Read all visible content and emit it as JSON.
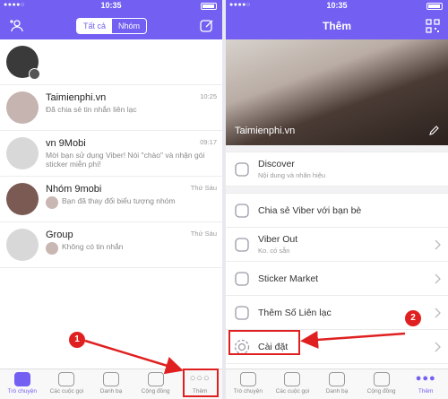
{
  "status": {
    "time": "10:35",
    "signal": "●●●●○"
  },
  "left": {
    "segment": [
      "Tất cả",
      "Nhóm"
    ],
    "chats": [
      {
        "name": "",
        "message": "",
        "time": "",
        "avatar": "#3a3a3a",
        "lock": true
      },
      {
        "name": "Taimienphi.vn",
        "message": "Đã chia sẻ tin nhắn liên lạc",
        "time": "10:25",
        "avatar": "#c5b4b0"
      },
      {
        "name": "vn 9Mobi",
        "message": "Mời bạn sử dụng Viber! Nói \"chào\" và nhận gói sticker miễn phí!",
        "time": "09:17",
        "avatar": "#d8d8d8"
      },
      {
        "name": "Nhóm 9mobi",
        "message": "Bạn đã thay đổi biểu tượng nhóm",
        "time": "Thứ Sáu",
        "avatar": "#7a5a52"
      },
      {
        "name": "Group",
        "message": "Không có tin nhắn",
        "time": "Thứ Sáu",
        "avatar": "#d8d8d8"
      }
    ],
    "tabs": [
      "Trò chuyện",
      "Các cuộc gọi",
      "Danh bạ",
      "Cộng đồng",
      "Thêm"
    ]
  },
  "right": {
    "title": "Thêm",
    "profile_name": "Taimienphi.vn",
    "menu": [
      {
        "label": "Discover",
        "sub": "Nội dung và nhãn hiệu"
      },
      {
        "label": "Chia sẻ Viber với bạn bè",
        "sub": ""
      },
      {
        "label": "Viber Out",
        "sub": "Ko. có sẵn"
      },
      {
        "label": "Sticker Market",
        "sub": ""
      },
      {
        "label": "Thêm Số Liên lạc",
        "sub": ""
      },
      {
        "label": "Cài đặt",
        "sub": ""
      }
    ],
    "tabs": [
      "Trò chuyện",
      "Các cuộc gọi",
      "Danh bạ",
      "Cộng đồng",
      "Thêm"
    ]
  },
  "annotations": {
    "step1": "1",
    "step2": "2"
  },
  "colors": {
    "brand": "#7360f2",
    "callout": "#e02020"
  }
}
